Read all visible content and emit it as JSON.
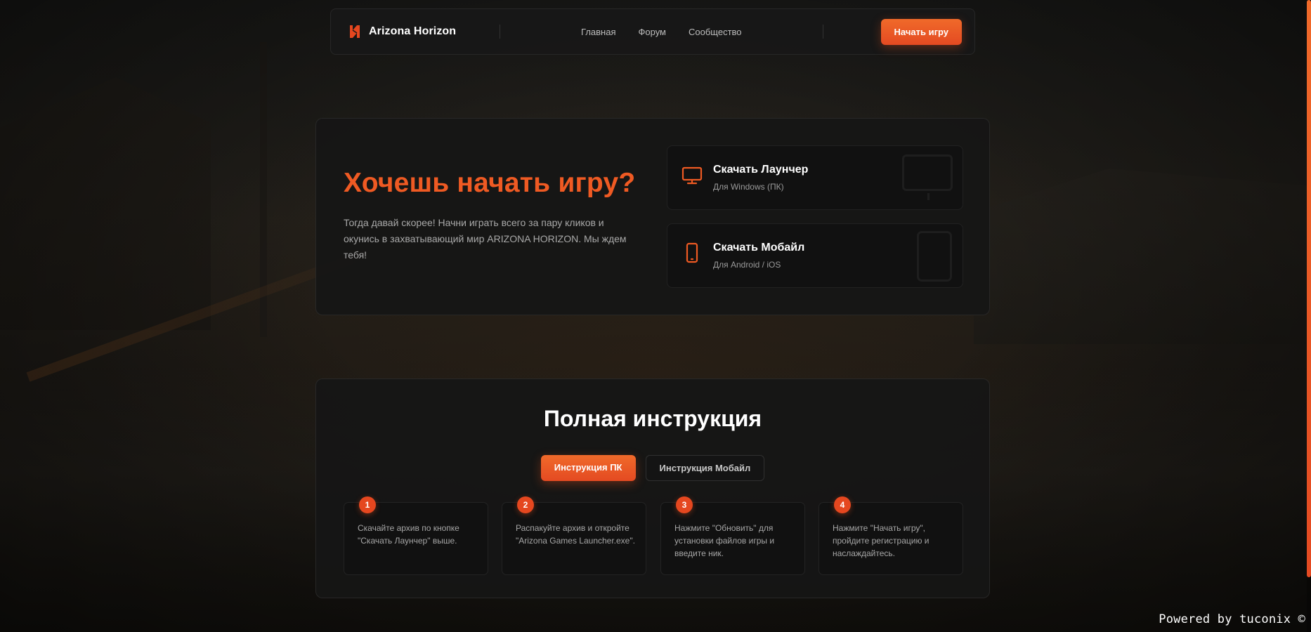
{
  "header": {
    "brand_name": "Arizona Horizon",
    "nav": [
      "Главная",
      "Форум",
      "Сообщество"
    ],
    "cta_label": "Начать игру"
  },
  "hero": {
    "title": "Хочешь начать игру?",
    "text": "Тогда давай скорее! Начни играть всего за пару кликов и окунись в захватывающий мир ARIZONA HORIZON. Мы ждем тебя!",
    "downloads": [
      {
        "title": "Скачать Лаунчер",
        "subtitle": "Для Windows (ПК)",
        "icon": "monitor-icon"
      },
      {
        "title": "Скачать Мобайл",
        "subtitle": "Для Android / iOS",
        "icon": "phone-icon"
      }
    ]
  },
  "instructions": {
    "title": "Полная инструкция",
    "tabs": [
      {
        "label": "Инструкция ПК",
        "active": true
      },
      {
        "label": "Инструкция Мобайл",
        "active": false
      }
    ],
    "steps": [
      {
        "num": "1",
        "text": "Скачайте архив по кнопке \"Скачать Лаунчер\" выше."
      },
      {
        "num": "2",
        "text": "Распакуйте архив и откройте \"Arizona Games Launcher.exe\"."
      },
      {
        "num": "3",
        "text": "Нажмите \"Обновить\" для установки файлов игры и введите ник."
      },
      {
        "num": "4",
        "text": "Нажмите \"Начать игру\", пройдите регистрацию и наслаждайтесь."
      }
    ]
  },
  "footer": {
    "powered": "Powered by tuconix ©"
  },
  "colors": {
    "accent": "#ef5a23",
    "accent_button": "#e44a22",
    "panel": "#161616",
    "card": "#111111"
  }
}
